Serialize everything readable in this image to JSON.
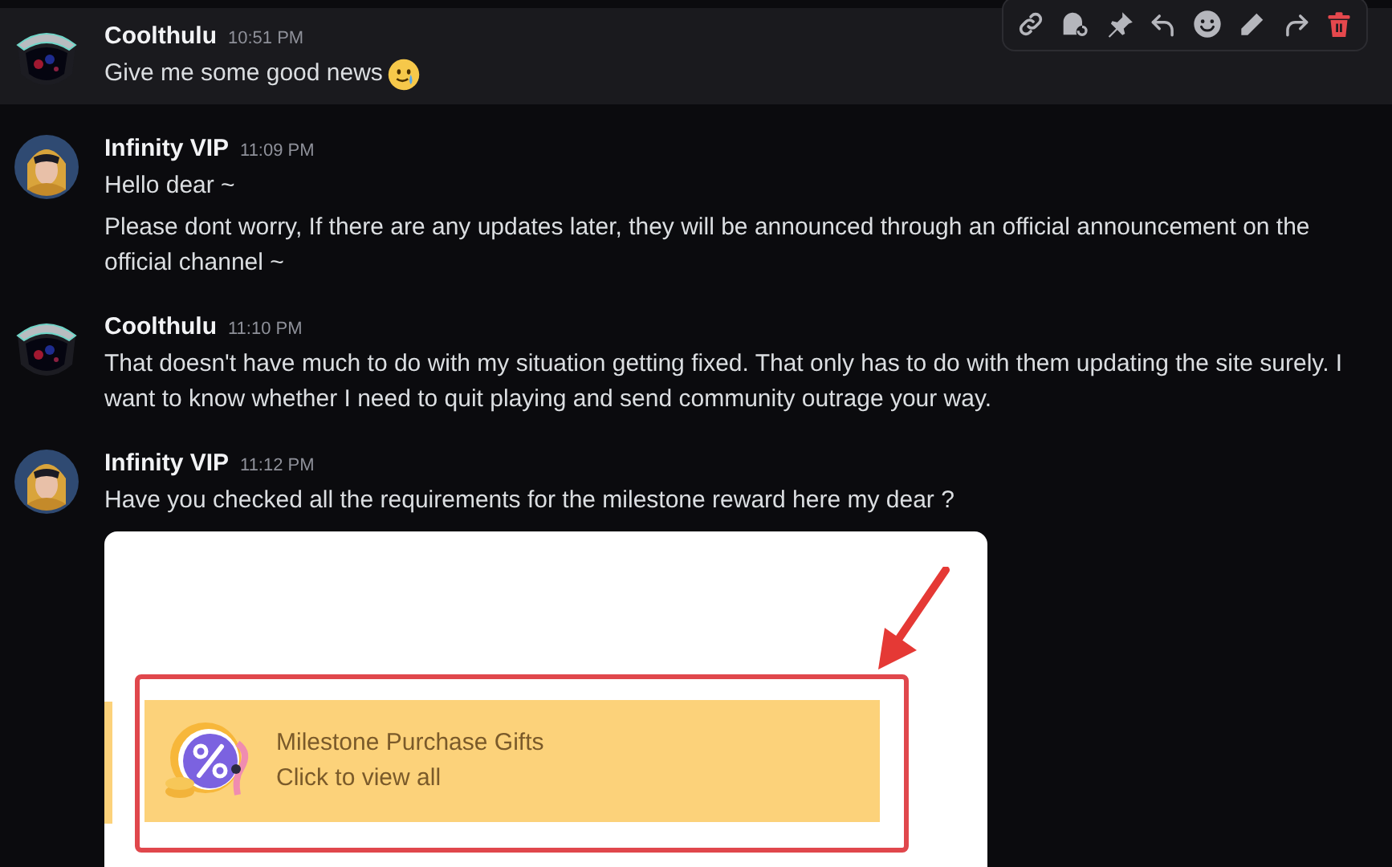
{
  "messages": [
    {
      "author": "Coolthulu",
      "time": "10:51 PM",
      "kind": "helmet",
      "highlighted": true,
      "paragraphs": [
        "Give me some good news"
      ],
      "emoji": true
    },
    {
      "author": "Infinity VIP",
      "time": "11:09 PM",
      "kind": "character",
      "highlighted": false,
      "paragraphs": [
        "Hello dear ~",
        "Please dont worry, If there are any updates later, they will be announced through an official announcement on the official channel ~"
      ]
    },
    {
      "author": "Coolthulu",
      "time": "11:10 PM",
      "kind": "helmet",
      "highlighted": false,
      "paragraphs": [
        "That doesn't have much to do with my situation getting fixed. That only has to do with them updating the site surely. I want to know whether I need to quit playing and send community outrage your way."
      ]
    },
    {
      "author": "Infinity VIP",
      "time": "11:12 PM",
      "kind": "character",
      "highlighted": false,
      "paragraphs": [
        "Have you checked all the requirements for the milestone reward here my dear ?"
      ],
      "attachment": {
        "title": "Milestone Purchase Gifts",
        "subtitle": "Click to view all"
      }
    }
  ]
}
